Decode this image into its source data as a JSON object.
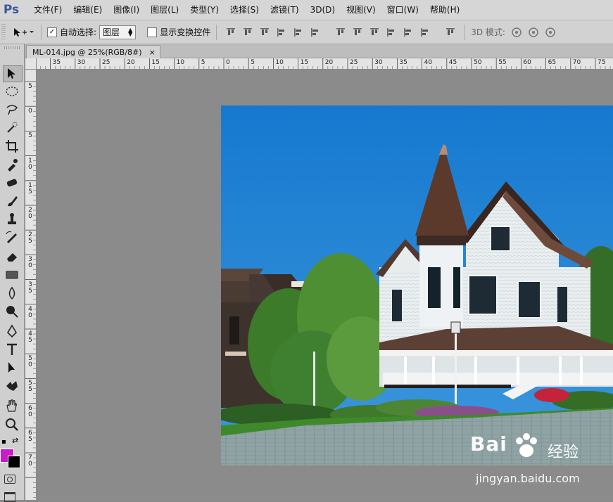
{
  "app": {
    "logo": "Ps"
  },
  "menu": [
    "文件(F)",
    "编辑(E)",
    "图像(I)",
    "图层(L)",
    "类型(Y)",
    "选择(S)",
    "滤镜(T)",
    "3D(D)",
    "视图(V)",
    "窗口(W)",
    "帮助(H)"
  ],
  "options": {
    "auto_select_label": "自动选择:",
    "auto_select_checked": "✓",
    "auto_select_target": "图层",
    "show_transform_label": "显示变换控件",
    "mode_3d_label": "3D 模式:"
  },
  "document": {
    "tab_title": "ML-014.jpg @ 25%(RGB/8#)",
    "close_glyph": "×"
  },
  "ruler_h": [
    "35",
    "30",
    "25",
    "20",
    "15",
    "10",
    "5",
    "0",
    "5",
    "10",
    "15",
    "20",
    "25",
    "30",
    "35",
    "40",
    "45",
    "50",
    "55",
    "60",
    "65",
    "70",
    "75"
  ],
  "ruler_v": [
    "5",
    "0",
    "5",
    "1\n0",
    "1\n5",
    "2\n0",
    "2\n5",
    "3\n0",
    "3\n5",
    "4\n0",
    "4\n5",
    "5\n0",
    "5\n5",
    "6\n0",
    "6\n5",
    "7\n0"
  ],
  "colors": {
    "foreground": "#c81bc9",
    "background": "#000000",
    "sky": "#1f7fd0"
  },
  "watermark": {
    "brand": "Bai",
    "brand_suffix": "经验",
    "url": "jingyan.baidu.com"
  }
}
